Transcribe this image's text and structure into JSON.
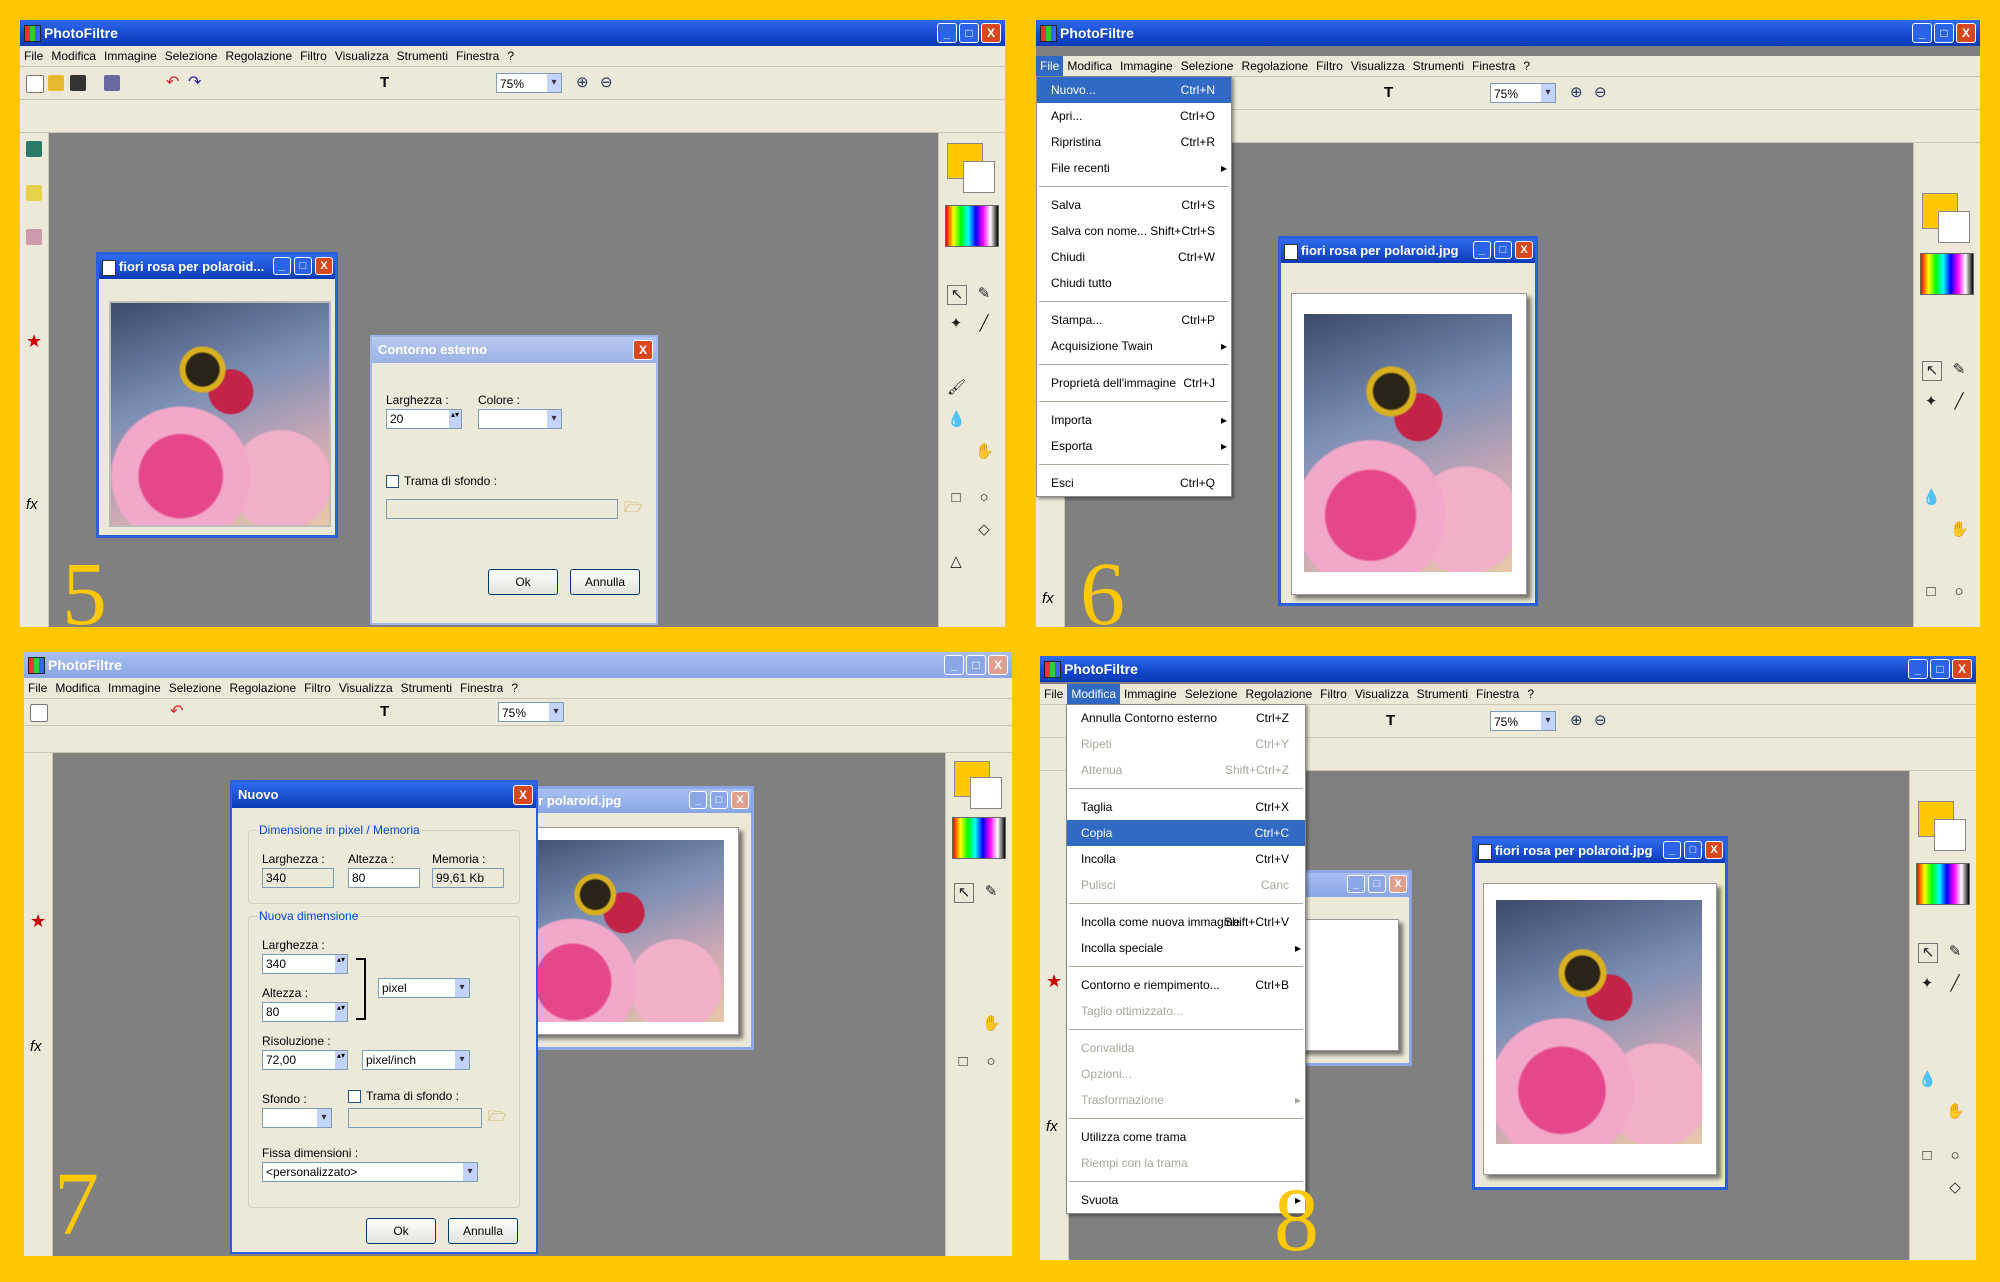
{
  "app_title": "PhotoFiltre",
  "menu": [
    "File",
    "Modifica",
    "Immagine",
    "Selezione",
    "Regolazione",
    "Filtro",
    "Visualizza",
    "Strumenti",
    "Finestra",
    "?"
  ],
  "zoom": "75%",
  "window_controls": {
    "minimize": "_",
    "maximize": "□",
    "close": "X"
  },
  "panel5": {
    "step": "5",
    "doc_title": "fiori rosa per polaroid...",
    "dialog": {
      "title": "Contorno esterno",
      "width_label": "Larghezza :",
      "width_value": "20",
      "color_label": "Colore :",
      "texture_label": "Trama di sfondo :",
      "ok": "Ok",
      "cancel": "Annulla"
    }
  },
  "panel6": {
    "step": "6",
    "doc_title": "fiori rosa per polaroid.jpg",
    "file_menu": [
      {
        "label": "Nuovo...",
        "shortcut": "Ctrl+N",
        "selected": true
      },
      {
        "label": "Apri...",
        "shortcut": "Ctrl+O"
      },
      {
        "label": "Ripristina",
        "shortcut": "Ctrl+R"
      },
      {
        "label": "File recenti",
        "shortcut": "",
        "submenu": true
      },
      {
        "sep": true
      },
      {
        "label": "Salva",
        "shortcut": "Ctrl+S"
      },
      {
        "label": "Salva con nome...",
        "shortcut": "Shift+Ctrl+S"
      },
      {
        "label": "Chiudi",
        "shortcut": "Ctrl+W"
      },
      {
        "label": "Chiudi tutto",
        "shortcut": ""
      },
      {
        "sep": true
      },
      {
        "label": "Stampa...",
        "shortcut": "Ctrl+P"
      },
      {
        "label": "Acquisizione Twain",
        "shortcut": "",
        "submenu": true
      },
      {
        "sep": true
      },
      {
        "label": "Proprietà dell'immagine",
        "shortcut": "Ctrl+J"
      },
      {
        "sep": true
      },
      {
        "label": "Importa",
        "shortcut": "",
        "submenu": true
      },
      {
        "label": "Esporta",
        "shortcut": "",
        "submenu": true
      },
      {
        "sep": true
      },
      {
        "label": "Esci",
        "shortcut": "Ctrl+Q"
      }
    ]
  },
  "panel7": {
    "step": "7",
    "doc_title": "osa per polaroid.jpg",
    "dialog": {
      "title": "Nuovo",
      "group1": "Dimensione in pixel / Memoria",
      "width_label": "Larghezza :",
      "width_value": "340",
      "height_label": "Altezza :",
      "height_value": "80",
      "memory_label": "Memoria :",
      "memory_value": "99,61 Kb",
      "group2": "Nuova dimensione",
      "new_width_label": "Larghezza :",
      "new_width_value": "340",
      "new_height_label": "Altezza :",
      "new_height_value": "80",
      "unit": "pixel",
      "resolution_label": "Risoluzione :",
      "resolution_value": "72,00",
      "resolution_unit": "pixel/inch",
      "background_label": "Sfondo :",
      "texture_label": "Trama di sfondo :",
      "preset_label": "Fissa dimensioni :",
      "preset_value": "<personalizzato>",
      "ok": "Ok",
      "cancel": "Annulla"
    }
  },
  "panel8": {
    "step": "8",
    "doc_title": "fiori rosa per polaroid.jpg",
    "edit_menu": [
      {
        "label": "Annulla Contorno esterno",
        "shortcut": "Ctrl+Z"
      },
      {
        "label": "Ripeti",
        "shortcut": "Ctrl+Y",
        "disabled": true
      },
      {
        "label": "Attenua",
        "shortcut": "Shift+Ctrl+Z",
        "disabled": true
      },
      {
        "sep": true
      },
      {
        "label": "Taglia",
        "shortcut": "Ctrl+X"
      },
      {
        "label": "Copia",
        "shortcut": "Ctrl+C",
        "selected": true
      },
      {
        "label": "Incolla",
        "shortcut": "Ctrl+V"
      },
      {
        "label": "Pulisci",
        "shortcut": "Canc",
        "disabled": true
      },
      {
        "sep": true
      },
      {
        "label": "Incolla come nuova immagine",
        "shortcut": "Shift+Ctrl+V"
      },
      {
        "label": "Incolla speciale",
        "shortcut": "",
        "submenu": true
      },
      {
        "sep": true
      },
      {
        "label": "Contorno e riempimento...",
        "shortcut": "Ctrl+B"
      },
      {
        "label": "Taglio ottimizzato...",
        "shortcut": "",
        "disabled": true
      },
      {
        "sep": true
      },
      {
        "label": "Convalida",
        "shortcut": "",
        "disabled": true
      },
      {
        "label": "Opzioni...",
        "shortcut": "",
        "disabled": true
      },
      {
        "label": "Trasformazione",
        "shortcut": "",
        "disabled": true,
        "submenu": true
      },
      {
        "sep": true
      },
      {
        "label": "Utilizza come trama",
        "shortcut": ""
      },
      {
        "label": "Riempi con la trama",
        "shortcut": "",
        "disabled": true
      },
      {
        "sep": true
      },
      {
        "label": "Svuota",
        "shortcut": "",
        "submenu": true
      }
    ]
  },
  "colors": {
    "accent": "#ffc800",
    "titlebar": "#1247c9",
    "workspace": "#808080",
    "chrome": "#ece9d8"
  }
}
